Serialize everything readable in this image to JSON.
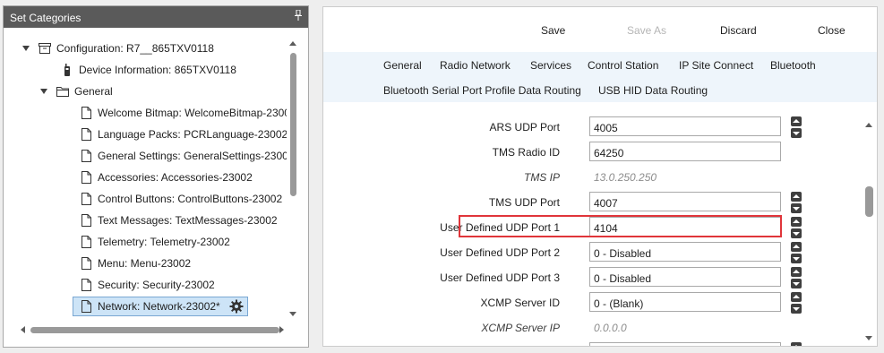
{
  "left_panel": {
    "title": "Set Categories",
    "tree": [
      {
        "label": "Configuration: R7__865TXV0118",
        "icon": "archive-icon",
        "expanded": true
      },
      {
        "label": "Device Information: 865TXV0118",
        "icon": "radio-device-icon"
      },
      {
        "label": "General",
        "icon": "folder-icon",
        "expanded": true
      },
      {
        "label": "Welcome Bitmap: WelcomeBitmap-2300",
        "icon": "document-icon"
      },
      {
        "label": "Language Packs: PCRLanguage-23002",
        "icon": "document-icon"
      },
      {
        "label": "General Settings: GeneralSettings-2300",
        "icon": "document-icon"
      },
      {
        "label": "Accessories: Accessories-23002",
        "icon": "document-icon"
      },
      {
        "label": "Control Buttons: ControlButtons-23002",
        "icon": "document-icon"
      },
      {
        "label": "Text Messages: TextMessages-23002",
        "icon": "document-icon"
      },
      {
        "label": "Telemetry: Telemetry-23002",
        "icon": "document-icon"
      },
      {
        "label": "Menu: Menu-23002",
        "icon": "document-icon"
      },
      {
        "label": "Security: Security-23002",
        "icon": "document-icon"
      },
      {
        "label": "Network: Network-23002*",
        "icon": "document-icon",
        "selected": true
      }
    ]
  },
  "toolbar": {
    "save": "Save",
    "save_as": "Save As",
    "discard": "Discard",
    "close": "Close"
  },
  "tabs": {
    "row1": [
      "General",
      "Radio Network",
      "Services",
      "Control Station",
      "IP Site Connect",
      "Bluetooth"
    ],
    "row2": [
      "Bluetooth Serial Port Profile Data Routing",
      "USB HID Data Routing"
    ]
  },
  "form": {
    "fields": [
      {
        "label": "ARS UDP Port",
        "value": "4005",
        "type": "spinner"
      },
      {
        "label": "TMS Radio ID",
        "value": "64250",
        "type": "text"
      },
      {
        "label": "TMS IP",
        "value": "13.0.250.250",
        "type": "readonly"
      },
      {
        "label": "TMS UDP Port",
        "value": "4007",
        "type": "spinner"
      },
      {
        "label": "User Defined UDP Port 1",
        "value": "4104",
        "type": "spinner",
        "highlighted": true
      },
      {
        "label": "User Defined UDP Port 2",
        "value": "0 - Disabled",
        "type": "spinner"
      },
      {
        "label": "User Defined UDP Port 3",
        "value": "0 - Disabled",
        "type": "spinner"
      },
      {
        "label": "XCMP Server ID",
        "value": "0 - (Blank)",
        "type": "spinner"
      },
      {
        "label": "XCMP Server IP",
        "value": "0.0.0.0",
        "type": "readonly"
      }
    ]
  },
  "colors": {
    "header_bg": "#5a5a5a",
    "tab_strip_bg": "#eef5fb",
    "selection_bg": "#cde4f7",
    "highlight_border": "#e0353a"
  }
}
